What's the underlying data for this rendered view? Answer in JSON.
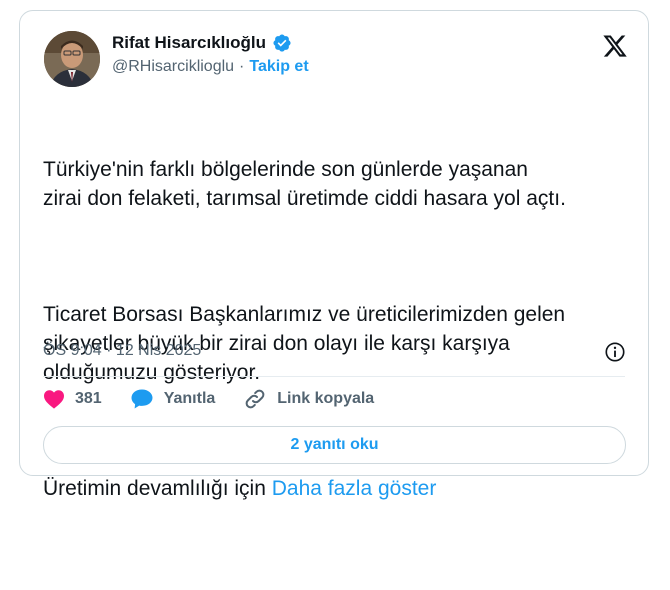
{
  "author": {
    "name": "Rifat Hisarcıklıoğlu",
    "handle": "@RHisarciklioglu",
    "separator": "·",
    "follow_label": "Takip et"
  },
  "tweet": {
    "paragraphs": [
      "Türkiye'nin farklı bölgelerinde son günlerde yaşanan\nzirai don felaketi, tarımsal üretimde ciddi hasara yol açtı.",
      "Ticaret Borsası Başkanlarımız ve üreticilerimizden gelen\nşikayetler büyük bir zirai don olayı ile karşı karşıya\nolduğumuzu gösteriyor."
    ],
    "truncated_text": "Üretimin devamlılığı için ",
    "show_more_label": "Daha fazla göster",
    "timestamp": "ÖS 9:04 · 12 Nis 2025"
  },
  "actions": {
    "like_count": "381",
    "reply_label": "Yanıtla",
    "copy_link_label": "Link kopyala"
  },
  "replies_button_label": "2 yanıtı oku",
  "icons": {
    "verified": "verified-badge-icon",
    "platform": "x-logo-icon",
    "info": "info-icon",
    "like": "heart-icon",
    "reply": "speech-bubble-icon",
    "link": "link-icon"
  },
  "colors": {
    "accent": "#1d9bf0",
    "like": "#f91880",
    "text": "#0f1419",
    "muted": "#536471",
    "border": "#cfd9de"
  }
}
